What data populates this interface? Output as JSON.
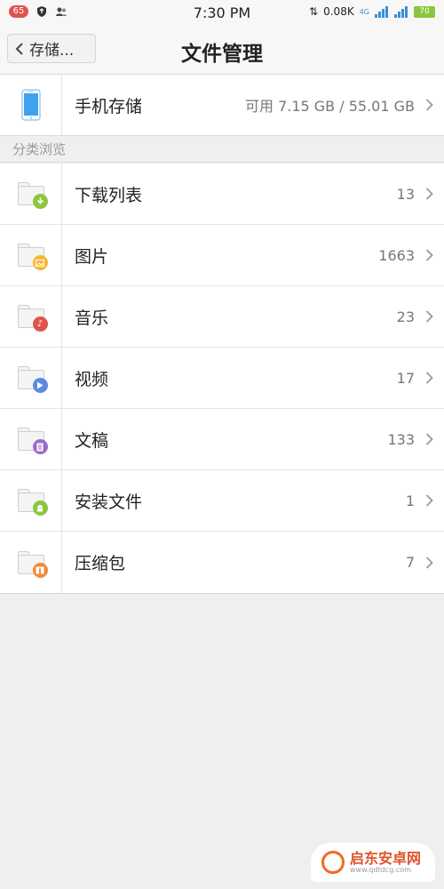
{
  "status_bar": {
    "notification_count": "65",
    "time": "7:30 PM",
    "net_speed": "0.08K",
    "network_type": "4G",
    "battery": "70"
  },
  "header": {
    "back_label": "存储...",
    "title": "文件管理"
  },
  "storage": {
    "label": "手机存储",
    "value": "可用 7.15 GB / 55.01 GB"
  },
  "section": {
    "title": "分类浏览"
  },
  "categories": [
    {
      "label": "下载列表",
      "count": "13",
      "icon": "download-icon",
      "color": "#8cc63f"
    },
    {
      "label": "图片",
      "count": "1663",
      "icon": "image-icon",
      "color": "#f5b931"
    },
    {
      "label": "音乐",
      "count": "23",
      "icon": "music-icon",
      "color": "#e0534a"
    },
    {
      "label": "视频",
      "count": "17",
      "icon": "play-icon",
      "color": "#5b8be0"
    },
    {
      "label": "文稿",
      "count": "133",
      "icon": "document-icon",
      "color": "#9b6cc9"
    },
    {
      "label": "安装文件",
      "count": "1",
      "icon": "android-icon",
      "color": "#8cc63f"
    },
    {
      "label": "压缩包",
      "count": "7",
      "icon": "archive-icon",
      "color": "#f08a3a"
    }
  ],
  "watermark": {
    "brand": "启东安卓网",
    "url": "www.qdtdcg.com"
  }
}
